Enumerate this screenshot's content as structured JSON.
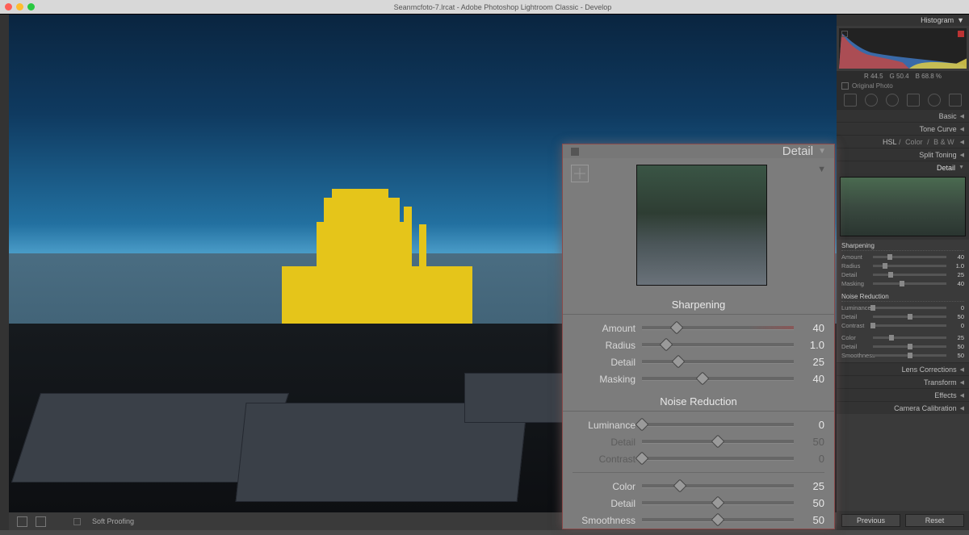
{
  "titlebar": {
    "title": "Seanmcfoto-7.lrcat - Adobe Photoshop Lightroom Classic - Develop"
  },
  "footer": {
    "soft_proofing": "Soft Proofing"
  },
  "right": {
    "histogram_label": "Histogram",
    "readout": {
      "r": "R  44.5",
      "g": "G  50.4",
      "b": "B  68.8 %"
    },
    "original_photo": "Original Photo",
    "panels": {
      "basic": "Basic",
      "tone_curve": "Tone Curve",
      "hsl": "HSL",
      "color": "Color",
      "bw": "B & W",
      "split_toning": "Split Toning",
      "detail": "Detail",
      "lens": "Lens Corrections",
      "transform": "Transform",
      "effects": "Effects",
      "camera_cal": "Camera Calibration"
    },
    "sharpening": {
      "title": "Sharpening",
      "amount_lbl": "Amount",
      "amount": "40",
      "radius_lbl": "Radius",
      "radius": "1.0",
      "detail_lbl": "Detail",
      "detail": "25",
      "masking_lbl": "Masking",
      "masking": "40"
    },
    "noise": {
      "title": "Noise Reduction",
      "luminance_lbl": "Luminance",
      "luminance": "0",
      "detail_lbl": "Detail",
      "detail": "50",
      "contrast_lbl": "Contrast",
      "contrast": "0",
      "color_lbl": "Color",
      "color": "25",
      "cdetail_lbl": "Detail",
      "cdetail": "50",
      "smooth_lbl": "Smoothness",
      "smooth": "50"
    },
    "buttons": {
      "previous": "Previous",
      "reset": "Reset"
    }
  },
  "popup": {
    "title": "Detail",
    "sharpening": {
      "title": "Sharpening",
      "rows": [
        {
          "label": "Amount",
          "value": "40",
          "pos": 23,
          "accent": true
        },
        {
          "label": "Radius",
          "value": "1.0",
          "pos": 16
        },
        {
          "label": "Detail",
          "value": "25",
          "pos": 24
        },
        {
          "label": "Masking",
          "value": "40",
          "pos": 40
        }
      ]
    },
    "noise": {
      "title": "Noise Reduction",
      "rows": [
        {
          "label": "Luminance",
          "value": "0",
          "pos": 0
        },
        {
          "label": "Detail",
          "value": "50",
          "pos": 50,
          "dis": true
        },
        {
          "label": "Contrast",
          "value": "0",
          "pos": 0,
          "dis": true
        }
      ],
      "rows2": [
        {
          "label": "Color",
          "value": "25",
          "pos": 25
        },
        {
          "label": "Detail",
          "value": "50",
          "pos": 50
        },
        {
          "label": "Smoothness",
          "value": "50",
          "pos": 50
        }
      ]
    }
  }
}
